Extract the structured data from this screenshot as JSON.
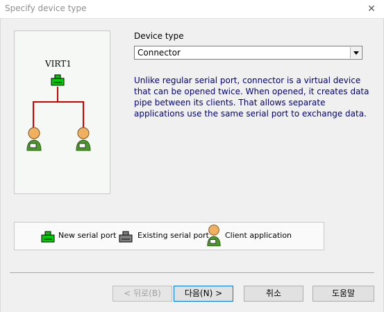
{
  "window": {
    "title": "Specify device type",
    "close_glyph": "✕"
  },
  "preview": {
    "device_name": "VIRT1"
  },
  "device_type": {
    "label": "Device type",
    "selected": "Connector",
    "description": "Unlike regular serial port, connector is a virtual device that can be opened twice. When opened, it creates data pipe between its clients. That allows separate applications use the same serial port to exchange data."
  },
  "legend": {
    "new_port": "New serial port",
    "existing_port": "Existing serial port",
    "client_app": "Client application"
  },
  "buttons": {
    "back": "< 뒤로(B)",
    "next": "다음(N) >",
    "cancel": "취소",
    "help": "도움말"
  },
  "colors": {
    "new_port": "#00cc00",
    "existing_port": "#808080",
    "link_line": "#d40000",
    "description_text": "#000080"
  },
  "icons": {
    "new_port": "serial-port-new-icon",
    "existing_port": "serial-port-existing-icon",
    "client": "client-application-icon"
  }
}
